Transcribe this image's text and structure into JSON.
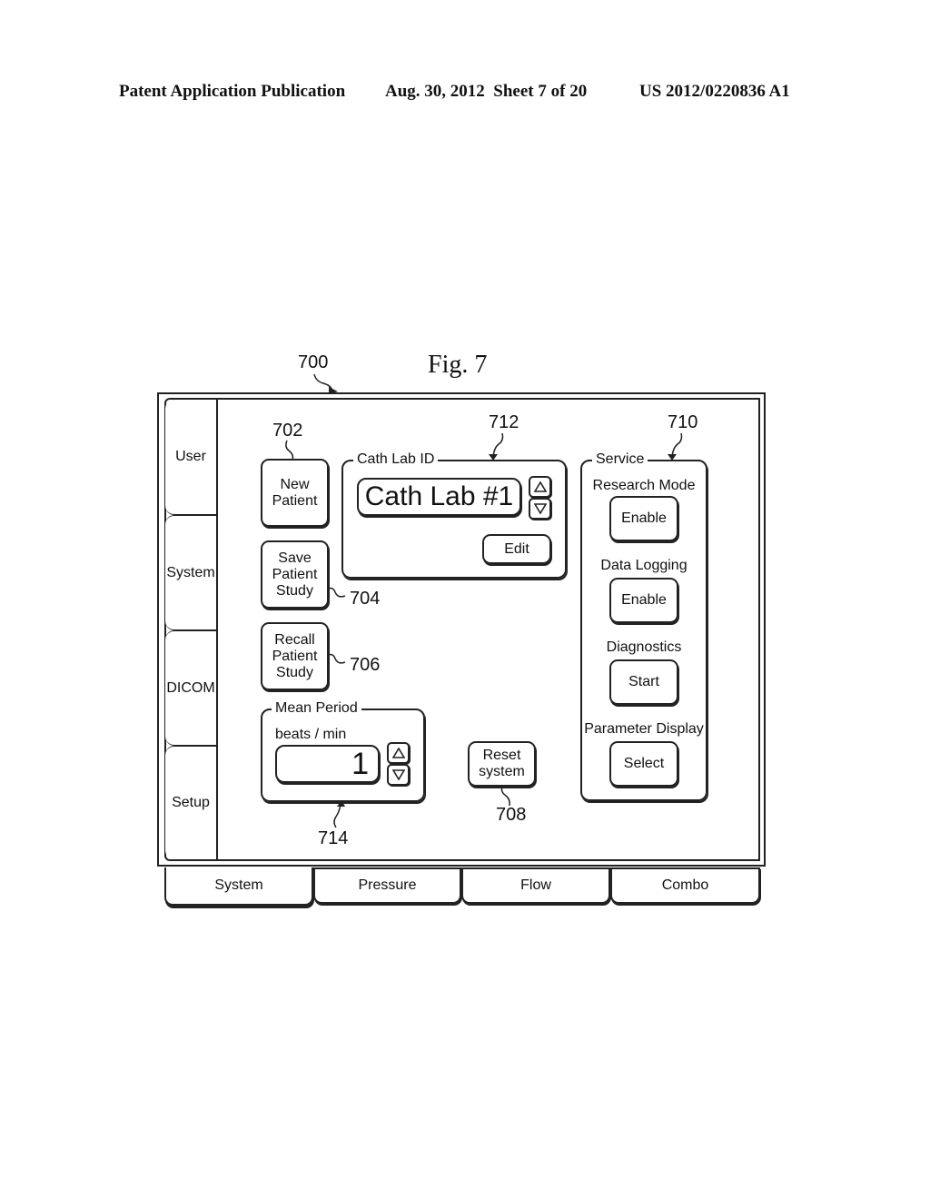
{
  "header": {
    "publication_type": "Patent Application Publication",
    "date_sheet": "Aug. 30, 2012  Sheet 7 of 20",
    "patent_number": "US 2012/0220836 A1"
  },
  "figure": {
    "title": "Fig. 7",
    "refs": {
      "screen": "700",
      "new_patient": "702",
      "save_study": "704",
      "recall_study": "706",
      "reset": "708",
      "service": "710",
      "cath_lab": "712",
      "mean_period": "714"
    }
  },
  "sidebar": {
    "items": [
      {
        "label": "User"
      },
      {
        "label": "System"
      },
      {
        "label": "DICOM"
      },
      {
        "label": "Setup"
      }
    ]
  },
  "actions": {
    "new_patient": "New\nPatient",
    "save_study": "Save\nPatient\nStudy",
    "recall_study": "Recall\nPatient\nStudy",
    "reset": "Reset\nsystem"
  },
  "cath_lab": {
    "legend": "Cath Lab ID",
    "value": "Cath Lab #1",
    "edit_label": "Edit",
    "up_icon": "triangle-up",
    "down_icon": "triangle-down"
  },
  "mean_period": {
    "legend": "Mean Period",
    "unit_label": "beats / min",
    "value": "1"
  },
  "service": {
    "legend": "Service",
    "items": [
      {
        "label": "Research Mode",
        "button": "Enable"
      },
      {
        "label": "Data Logging",
        "button": "Enable"
      },
      {
        "label": "Diagnostics",
        "button": "Start"
      },
      {
        "label": "Parameter Display",
        "button": "Select"
      }
    ]
  },
  "bottom_tabs": {
    "active": "System",
    "items": [
      {
        "label": "System"
      },
      {
        "label": "Pressure"
      },
      {
        "label": "Flow"
      },
      {
        "label": "Combo"
      }
    ]
  }
}
